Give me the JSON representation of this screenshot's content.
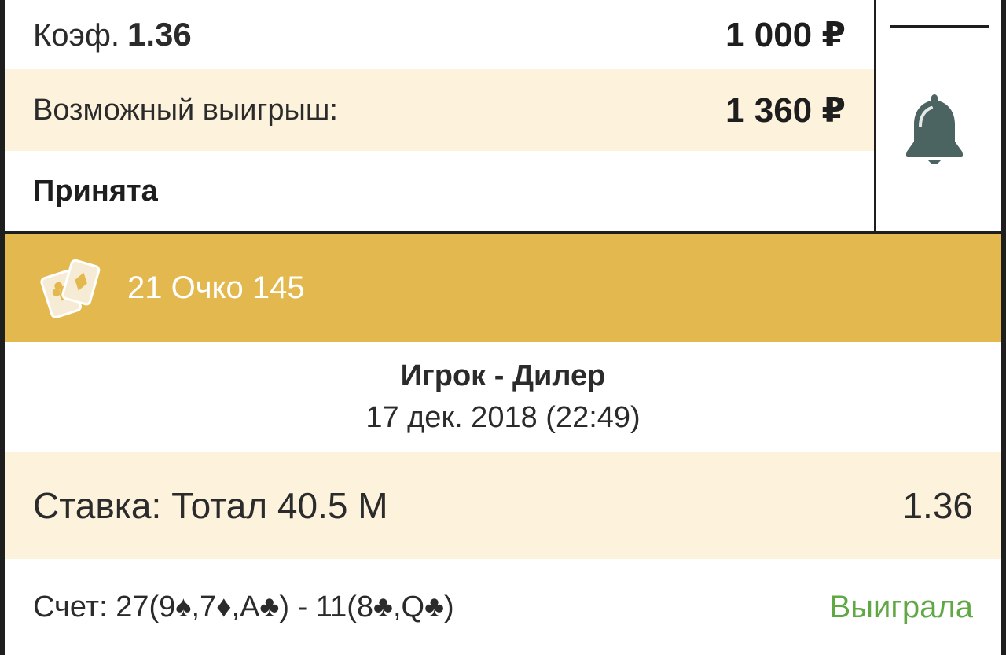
{
  "summary": {
    "coef_label": "Коэф.",
    "coef_value": "1.36",
    "stake": "1 000 ₽",
    "possible_win_label": "Возможный выигрыш:",
    "possible_win": "1 360 ₽",
    "status": "Принята",
    "bell_icon": "bell-icon"
  },
  "event": {
    "icon": "playing-cards-icon",
    "title": "21 Очко 145",
    "teams": "Игрок - Дилер",
    "date": "17 дек. 2018 (22:49)"
  },
  "bet": {
    "label": "Ставка: Тотал 40.5 М",
    "odds": "1.36"
  },
  "score": {
    "text": "Счет: 27(9♠,7♦,A♣) - 11(8♣,Q♣)",
    "result": "Выиграла"
  },
  "colors": {
    "accent_banner": "#e3b84f",
    "highlight_row": "#fdf2dc",
    "win_green": "#5fa844",
    "bell": "#4b6361"
  }
}
